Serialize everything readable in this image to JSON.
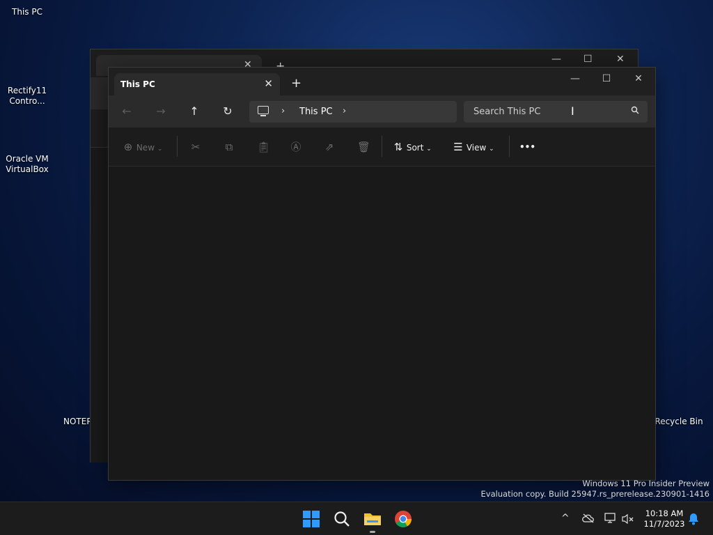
{
  "desktop": {
    "icons": [
      {
        "label": "This PC"
      },
      {
        "label": "Rectify11\nContro..."
      },
      {
        "label": "Oracle VM\nVirtualBox"
      },
      {
        "label": "NOTEPA"
      },
      {
        "label": "Recycle Bin"
      }
    ],
    "watermark_line1": "Windows 11 Pro Insider Preview",
    "watermark_line2": "Evaluation copy. Build 25947.rs_prerelease.230901-1416"
  },
  "explorer": {
    "tab_title": "This PC",
    "tab_close": "✕",
    "new_tab": "+",
    "minimize": "—",
    "maximize": "☐",
    "close": "✕",
    "nav": {
      "back": "←",
      "forward": "→",
      "up": "↑",
      "refresh": "↻"
    },
    "address": {
      "crumb": "This PC",
      "chevron": "›"
    },
    "search": {
      "placeholder": "Search This PC",
      "caret": "I"
    },
    "toolbar": {
      "new_label": "New",
      "sort_label": "Sort",
      "view_label": "View",
      "more_label": "•••"
    }
  },
  "taskbar": {
    "time": "10:18 AM",
    "date": "11/7/2023",
    "tray_chevron": "^"
  },
  "colors": {
    "accent": "#0a84ff",
    "windows_logo": "#2f9bff",
    "folder_yellow": "#f2c037"
  }
}
